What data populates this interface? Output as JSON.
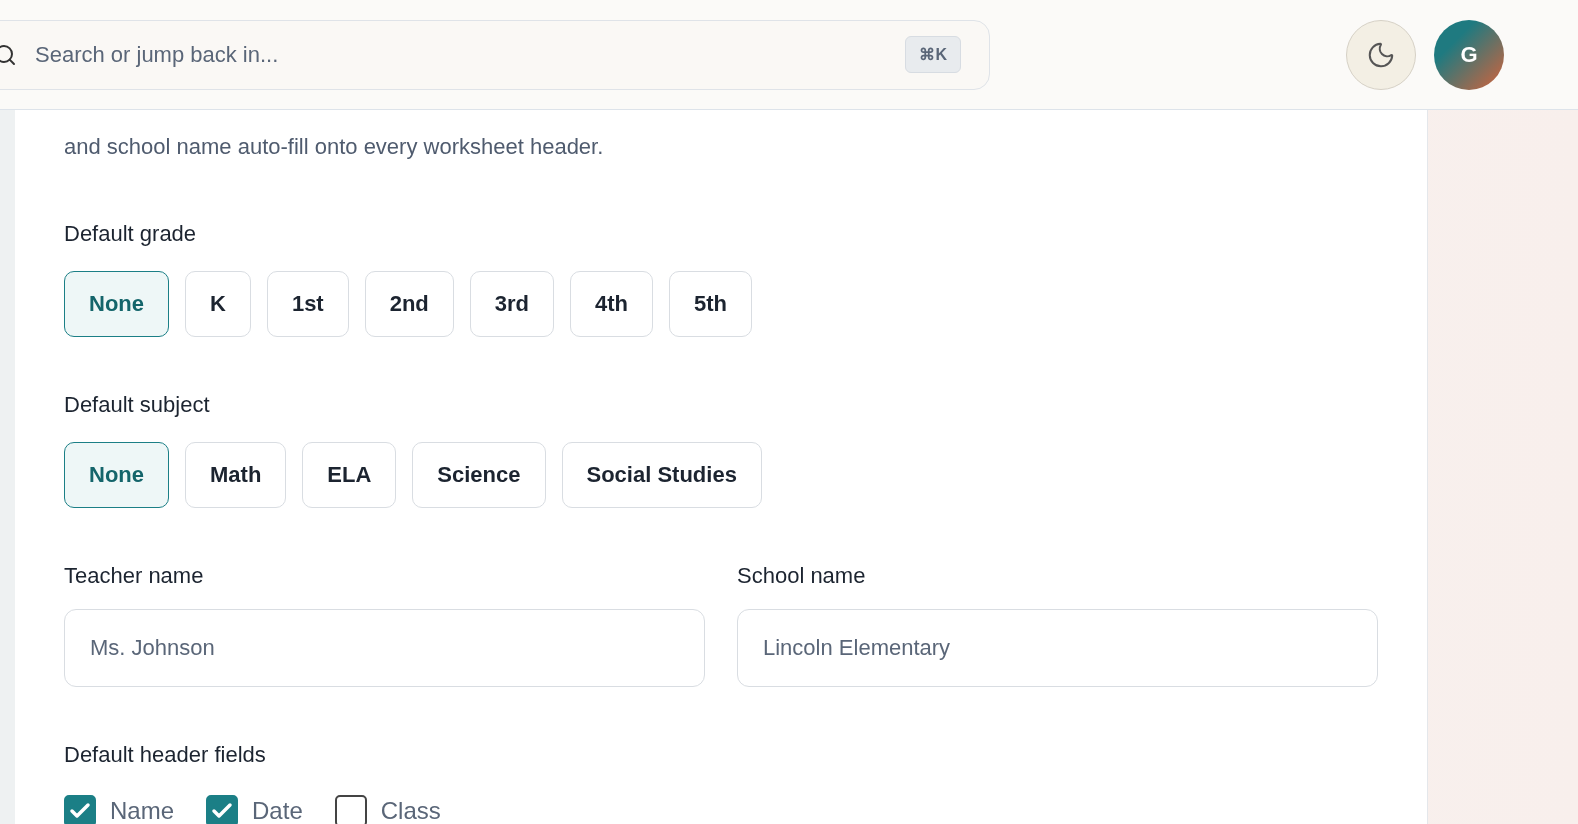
{
  "search": {
    "placeholder": "Search or jump back in...",
    "shortcut": "⌘K"
  },
  "avatar": {
    "initial": "G"
  },
  "intro": "and school name auto-fill onto every worksheet header.",
  "grade": {
    "label": "Default grade",
    "options": [
      {
        "label": "None",
        "selected": true
      },
      {
        "label": "K",
        "selected": false
      },
      {
        "label": "1st",
        "selected": false
      },
      {
        "label": "2nd",
        "selected": false
      },
      {
        "label": "3rd",
        "selected": false
      },
      {
        "label": "4th",
        "selected": false
      },
      {
        "label": "5th",
        "selected": false
      }
    ]
  },
  "subject": {
    "label": "Default subject",
    "options": [
      {
        "label": "None",
        "selected": true
      },
      {
        "label": "Math",
        "selected": false
      },
      {
        "label": "ELA",
        "selected": false
      },
      {
        "label": "Science",
        "selected": false
      },
      {
        "label": "Social Studies",
        "selected": false
      }
    ]
  },
  "fields": [
    {
      "label": "Teacher name",
      "placeholder": "Ms. Johnson"
    },
    {
      "label": "School name",
      "placeholder": "Lincoln Elementary"
    }
  ],
  "header_fields": {
    "label": "Default header fields",
    "options": [
      {
        "label": "Name",
        "checked": true
      },
      {
        "label": "Date",
        "checked": true
      },
      {
        "label": "Class",
        "checked": false
      }
    ]
  }
}
